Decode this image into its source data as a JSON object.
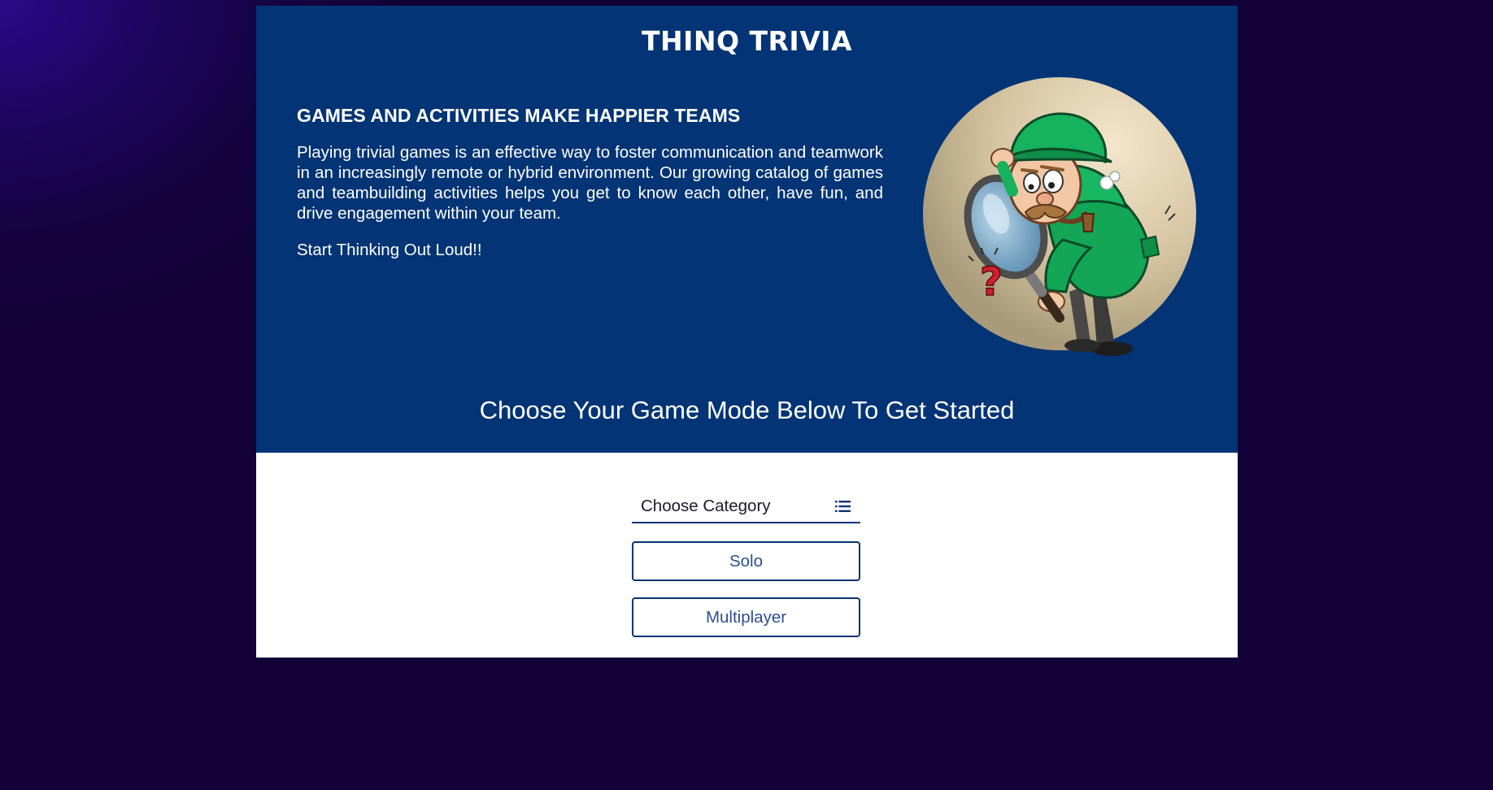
{
  "header": {
    "site_title": "THINQ TRIVIA"
  },
  "intro": {
    "heading": "GAMES AND ACTIVITIES MAKE HAPPIER TEAMS",
    "paragraph": "Playing trivial games is an effective way to foster communication and teamwork in an increasingly remote or hybrid environment. Our growing catalog of games and teambuilding activities helps you get to know each other, have fun, and drive engagement within your team.",
    "tagline": "Start Thinking Out Loud!!"
  },
  "mascot": {
    "icon": "detective-with-magnifying-glass-illustration"
  },
  "game_mode": {
    "prompt": "Choose Your Game Mode Below To Get Started"
  },
  "controls": {
    "category_select": {
      "label": "Choose Category",
      "icon": "list-icon"
    },
    "solo_label": "Solo",
    "multiplayer_label": "Multiplayer"
  },
  "colors": {
    "hero_background": "#033475",
    "accent": "#033475",
    "button_text": "#2d4f92",
    "page_background": "#120238"
  }
}
